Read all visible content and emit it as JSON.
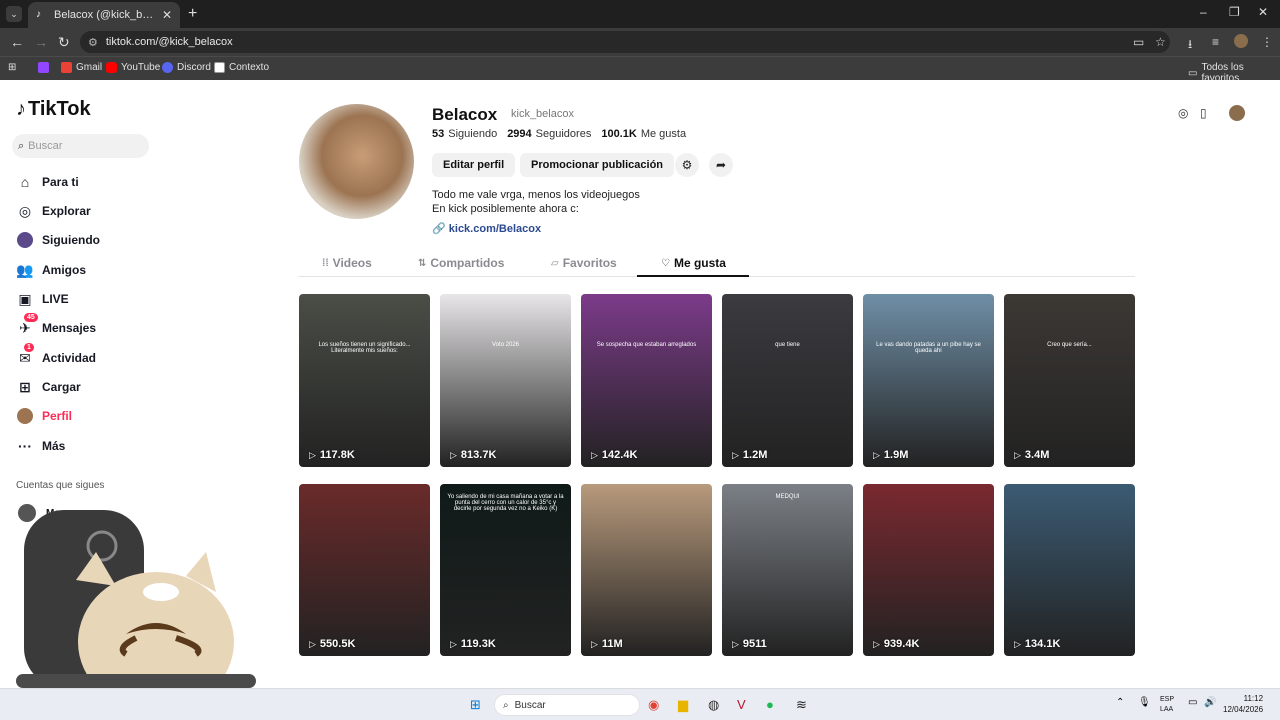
{
  "browser": {
    "tab_title": "Belacox (@kick_belacox) | TikTok",
    "url": "tiktok.com/@kick_belacox",
    "bookmarks": [
      {
        "label": "Gmail",
        "color": "#ea4335"
      },
      {
        "label": "YouTube",
        "color": "#ff0000"
      },
      {
        "label": "Discord",
        "color": "#5865f2"
      },
      {
        "label": "Contexto",
        "color": "#ffffff"
      }
    ],
    "all_bookmarks": "Todos los favoritos"
  },
  "sidebar": {
    "logo": "TikTok",
    "search_placeholder": "Buscar",
    "items": [
      {
        "label": "Para ti",
        "icon": "home-icon"
      },
      {
        "label": "Explorar",
        "icon": "compass-icon"
      },
      {
        "label": "Siguiendo",
        "icon": "following-icon"
      },
      {
        "label": "Amigos",
        "icon": "friends-icon"
      },
      {
        "label": "LIVE",
        "icon": "live-icon"
      },
      {
        "label": "Mensajes",
        "icon": "messages-icon",
        "badge": "45"
      },
      {
        "label": "Actividad",
        "icon": "activity-icon",
        "badge": "1"
      },
      {
        "label": "Cargar",
        "icon": "upload-icon"
      },
      {
        "label": "Perfil",
        "icon": "profile-icon"
      },
      {
        "label": "Más",
        "icon": "more-icon"
      }
    ],
    "following_header": "Cuentas que sigues",
    "following_first": "Mau"
  },
  "profile": {
    "name": "Belacox",
    "username": "kick_belacox",
    "following_count": "53",
    "following_label": "Siguiendo",
    "followers_count": "2994",
    "followers_label": "Seguidores",
    "likes_count": "100.1K",
    "likes_label": "Me gusta",
    "edit_button": "Editar perfil",
    "promote_button": "Promocionar publicación",
    "bio_line1": "Todo me vale vrga, menos los videojuegos",
    "bio_line2": "En kick posiblemente ahora c:",
    "link": "kick.com/Belacox"
  },
  "tabs": [
    {
      "label": "Videos"
    },
    {
      "label": "Compartidos"
    },
    {
      "label": "Favoritos"
    },
    {
      "label": "Me gusta"
    }
  ],
  "videos": [
    {
      "views": "117.8K",
      "caption": "Los sueños tienen un significado... Literalmente mis sueños:",
      "bg": "#4a4e46"
    },
    {
      "views": "813.7K",
      "caption": "Voto 2026",
      "bg": "#e8e6e8"
    },
    {
      "views": "142.4K",
      "caption": "Se sospecha que estaban arreglados",
      "bg": "#7c3b8a"
    },
    {
      "views": "1.2M",
      "caption": "que tiene",
      "bg": "#3b3b40"
    },
    {
      "views": "1.9M",
      "caption": "Le vas dando patadas a un pibe hay se queda ahí",
      "bg": "#6f8fa6"
    },
    {
      "views": "3.4M",
      "caption": "Creo que sería...",
      "bg": "#3c3834"
    },
    {
      "views": "550.5K",
      "caption": "",
      "bg": "#6a2a2a"
    },
    {
      "views": "119.3K",
      "caption": "Yo saliendo de mi casa mañana a votar a la punta del cerro con un calor de 35°c y decirle por segunda vez no a Keiko (K)",
      "bg": "#0f1a18"
    },
    {
      "views": "11M",
      "caption": "",
      "bg": "#b89a7c"
    },
    {
      "views": "9511",
      "caption": "MEDQUI",
      "bg": "#7b8086"
    },
    {
      "views": "939.4K",
      "caption": "",
      "bg": "#7a2930"
    },
    {
      "views": "134.1K",
      "caption": "",
      "bg": "#3b5b73"
    }
  ],
  "taskbar": {
    "search": "Buscar",
    "lang1": "ESP",
    "lang2": "LAA",
    "time": "11:12",
    "date": "12/04/2026"
  }
}
